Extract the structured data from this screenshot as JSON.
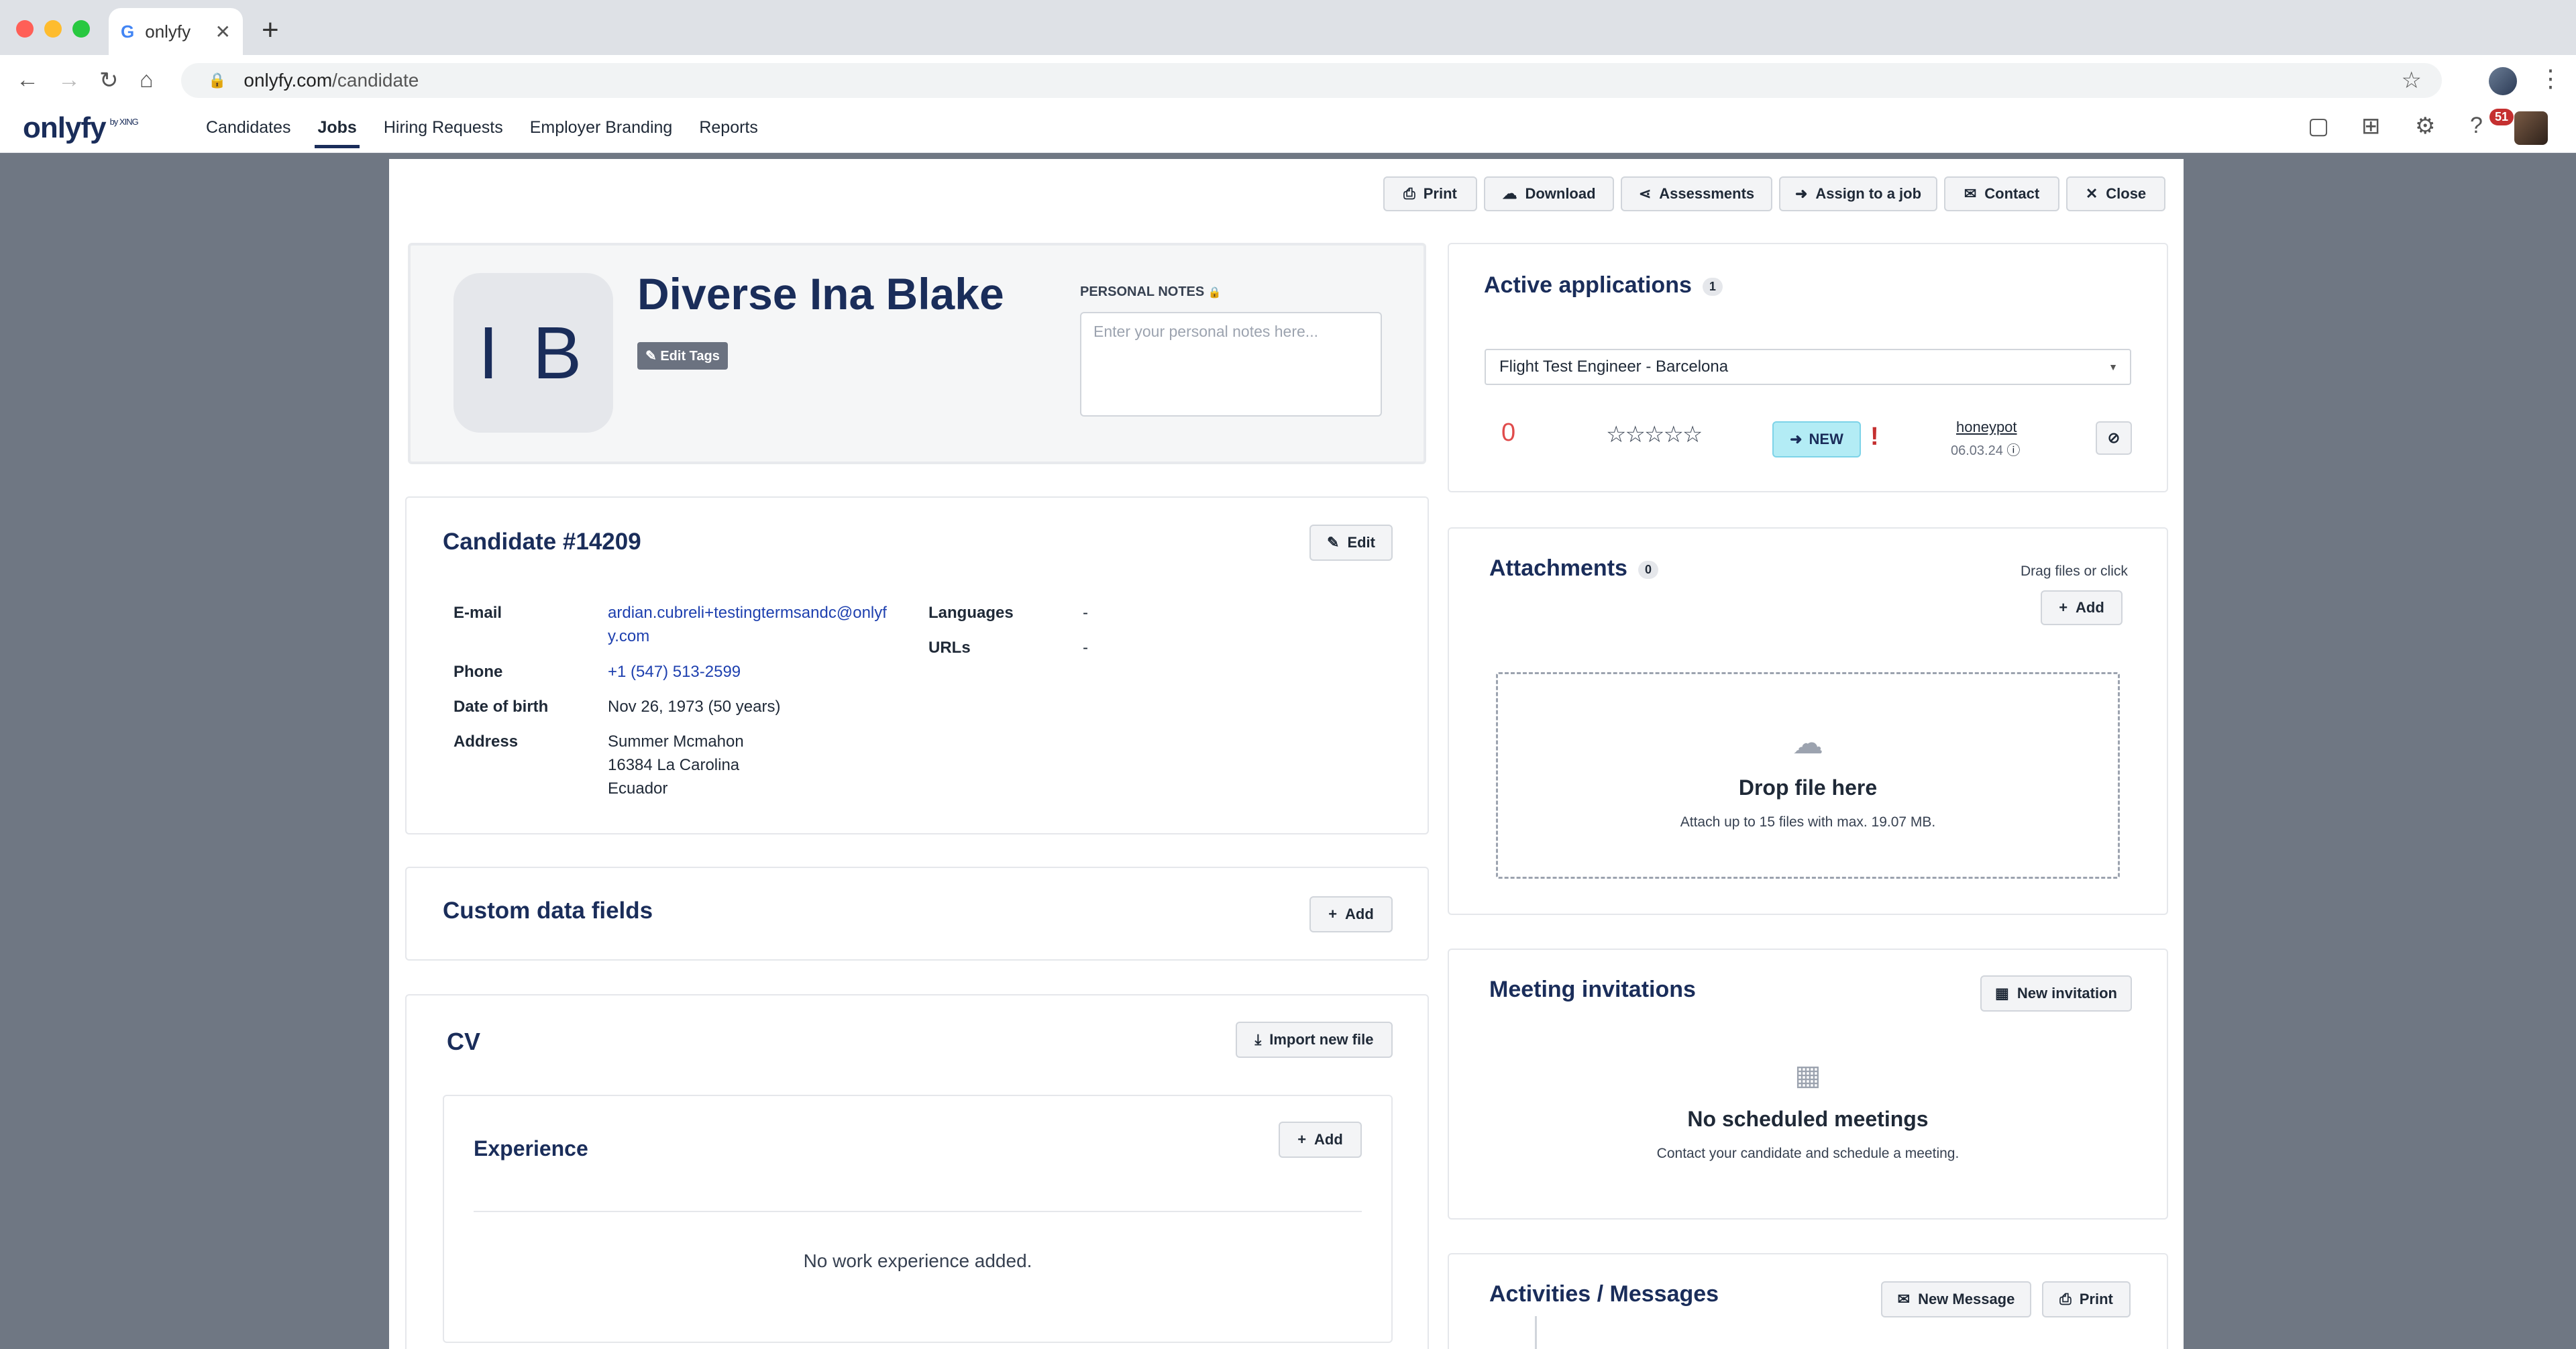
{
  "browser": {
    "tab_title": "onlyfy",
    "tab_favicon": "G",
    "url_host": "onlyfy.com",
    "url_path": "/candidate"
  },
  "app": {
    "logo": "onlyfy",
    "logo_suffix": "by XING",
    "nav": [
      "Candidates",
      "Jobs",
      "Hiring Requests",
      "Employer Branding",
      "Reports"
    ],
    "active_nav": "Jobs",
    "notification_count": "51"
  },
  "toolbar": {
    "print": "Print",
    "download": "Download",
    "assessments": "Assessments",
    "assign": "Assign to a job",
    "contact": "Contact",
    "close": "Close"
  },
  "profile": {
    "initials": "I B",
    "name": "Diverse Ina Blake",
    "edit_tags": "Edit Tags",
    "notes_label": "PERSONAL NOTES",
    "notes_placeholder": "Enter your personal notes here..."
  },
  "candidate": {
    "title": "Candidate #14209",
    "edit": "Edit",
    "email_label": "E-mail",
    "email_line1": "ardian.cubreli+testingtermsandc@onlyf",
    "email_line2": "y.com",
    "phone_label": "Phone",
    "phone": "+1 (547) 513-2599",
    "dob_label": "Date of birth",
    "dob": "Nov 26, 1973 (50 years)",
    "address_label": "Address",
    "address_line1": "Summer Mcmahon",
    "address_line2": "16384 La Carolina",
    "address_line3": "Ecuador",
    "languages_label": "Languages",
    "languages": "-",
    "urls_label": "URLs",
    "urls": "-"
  },
  "custom_fields": {
    "title": "Custom data fields",
    "add": "Add"
  },
  "cv": {
    "title": "CV",
    "import": "Import new file",
    "experience_title": "Experience",
    "add": "Add",
    "empty": "No work experience added."
  },
  "applications": {
    "title": "Active applications",
    "count": "1",
    "selected_job": "Flight Test Engineer - Barcelona",
    "score": "0",
    "rating": "☆☆☆☆☆",
    "status": "NEW",
    "source": "honeypot",
    "date": "06.03.24"
  },
  "attachments": {
    "title": "Attachments",
    "count": "0",
    "hint": "Drag files or click",
    "add": "Add",
    "drop_title": "Drop file here",
    "drop_sub": "Attach up to 15 files with max. 19.07 MB."
  },
  "meetings": {
    "title": "Meeting invitations",
    "new": "New invitation",
    "empty_title": "No scheduled meetings",
    "empty_sub": "Contact your candidate and schedule a meeting."
  },
  "activities": {
    "title": "Activities / Messages",
    "new_message": "New Message",
    "print": "Print"
  },
  "colors": {
    "brand": "#1a2d5a",
    "link": "#1e40af",
    "status_new": "#b3ecf5",
    "score": "#e04b4b",
    "alert": "#c53030"
  }
}
